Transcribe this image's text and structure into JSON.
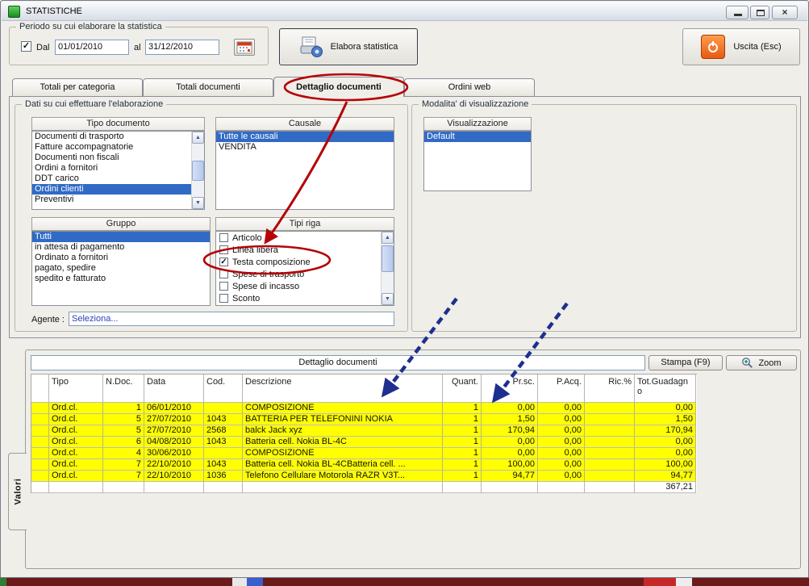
{
  "colors": {
    "selection_blue": "#316ac5",
    "highlight_yellow": "#ffff00",
    "annotation_red": "#b40407",
    "annotation_blue": "#1e2f8f",
    "exit_orange": "#e85a12",
    "link_blue": "#2b3dbf"
  },
  "icons": {
    "scroll_up": "▲",
    "scroll_down": "▼",
    "close": "×",
    "check": "✓"
  },
  "window": {
    "title": "STATISTICHE"
  },
  "period": {
    "group_label": "Periodo su cui elaborare la statistica",
    "dal_label": "Dal",
    "dal_value": "01/01/2010",
    "al_label": "al",
    "al_value": "31/12/2010"
  },
  "toolbar": {
    "elabora_label": "Elabora statistica",
    "uscita_label": "Uscita (Esc)"
  },
  "tabs": [
    "Totali per categoria",
    "Totali documenti",
    "Dettaglio documenti",
    "Ordini web"
  ],
  "dati": {
    "group_label": "Dati su cui effettuare l'elaborazione",
    "tipo_documento": {
      "header": "Tipo documento",
      "items": [
        "Documenti di trasporto",
        "Fatture accompagnatorie",
        "Documenti non fiscali",
        "Ordini a fornitori",
        "DDT carico",
        "Ordini clienti",
        "Preventivi"
      ],
      "selected": "Ordini clienti"
    },
    "causale": {
      "header": "Causale",
      "items": [
        "Tutte le causali",
        "VENDITA"
      ],
      "selected": "Tutte le causali"
    },
    "gruppo": {
      "header": "Gruppo",
      "items": [
        "Tutti",
        "in attesa di pagamento",
        "Ordinato a fornitori",
        "pagato, spedire",
        "spedito e fatturato"
      ],
      "selected": "Tutti"
    },
    "tipi_riga": {
      "header": "Tipi riga",
      "items": [
        {
          "label": "Articolo",
          "checked": false
        },
        {
          "label": "Linea libera",
          "checked": false
        },
        {
          "label": "Testa composizione",
          "checked": true
        },
        {
          "label": "Spese di trasporto",
          "checked": false
        },
        {
          "label": "Spese di incasso",
          "checked": false
        },
        {
          "label": "Sconto",
          "checked": false
        }
      ]
    },
    "agente_label": "Agente :",
    "agente_value": "Seleziona..."
  },
  "visualizzazione": {
    "group_label": "Modalita' di visualizzazione",
    "header": "Visualizzazione",
    "items": [
      "Default"
    ],
    "selected": "Default"
  },
  "results": {
    "panel_title": "Dettaglio documenti",
    "stampa_label": "Stampa (F9)",
    "zoom_label": "Zoom",
    "valori_tab": "Valori",
    "columns": [
      "Tipo",
      "N.Doc.",
      "Data",
      "Cod.",
      "Descrizione",
      "Quant.",
      "Pr.sc.",
      "P.Acq.",
      "Ric.%",
      "Tot.Guadagno"
    ],
    "rows": [
      [
        "Ord.cl.",
        "1",
        "06/01/2010",
        "",
        "COMPOSIZIONE",
        "1",
        "0,00",
        "0,00",
        "",
        "0,00"
      ],
      [
        "Ord.cl.",
        "5",
        "27/07/2010",
        "1043",
        "BATTERIA PER TELEFONINI NOKIA",
        "1",
        "1,50",
        "0,00",
        "",
        "1,50"
      ],
      [
        "Ord.cl.",
        "5",
        "27/07/2010",
        "2568",
        "balck Jack xyz",
        "1",
        "170,94",
        "0,00",
        "",
        "170,94"
      ],
      [
        "Ord.cl.",
        "6",
        "04/08/2010",
        "1043",
        "Batteria cell. Nokia BL-4C",
        "1",
        "0,00",
        "0,00",
        "",
        "0,00"
      ],
      [
        "Ord.cl.",
        "4",
        "30/06/2010",
        "",
        "COMPOSIZIONE",
        "1",
        "0,00",
        "0,00",
        "",
        "0,00"
      ],
      [
        "Ord.cl.",
        "7",
        "22/10/2010",
        "1043",
        "Batteria cell. Nokia BL-4CBatteria cell. ...",
        "1",
        "100,00",
        "0,00",
        "",
        "100,00"
      ],
      [
        "Ord.cl.",
        "7",
        "22/10/2010",
        "1036",
        "Telefono Cellulare Motorola RAZR V3T...",
        "1",
        "94,77",
        "0,00",
        "",
        "94,77"
      ]
    ],
    "total": "367,21"
  }
}
